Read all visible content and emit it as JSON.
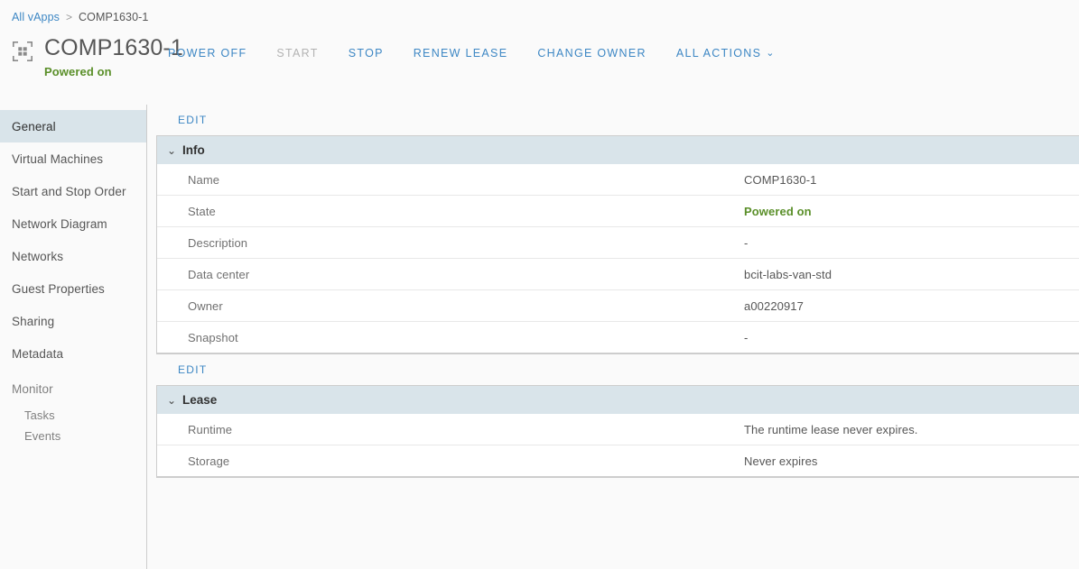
{
  "breadcrumb": {
    "root_label": "All vApps",
    "separator": ">",
    "current_label": "COMP1630-1"
  },
  "header": {
    "icon": "vapp-icon",
    "title": "COMP1630-1",
    "status": "Powered on",
    "status_color": "#5a8f29",
    "actions": [
      {
        "label": "POWER OFF",
        "disabled": false,
        "caret": ""
      },
      {
        "label": "START",
        "disabled": true,
        "caret": ""
      },
      {
        "label": "STOP",
        "disabled": false,
        "caret": ""
      },
      {
        "label": "RENEW LEASE",
        "disabled": false,
        "caret": ""
      },
      {
        "label": "CHANGE OWNER",
        "disabled": false,
        "caret": ""
      },
      {
        "label": "ALL ACTIONS",
        "disabled": false,
        "caret": "⌄"
      }
    ]
  },
  "sidebar": {
    "items": [
      {
        "label": "General",
        "selected": true,
        "kind": "item"
      },
      {
        "label": "Virtual Machines",
        "selected": false,
        "kind": "item"
      },
      {
        "label": "Start and Stop Order",
        "selected": false,
        "kind": "item"
      },
      {
        "label": "Network Diagram",
        "selected": false,
        "kind": "item"
      },
      {
        "label": "Networks",
        "selected": false,
        "kind": "item"
      },
      {
        "label": "Guest Properties",
        "selected": false,
        "kind": "item"
      },
      {
        "label": "Sharing",
        "selected": false,
        "kind": "item"
      },
      {
        "label": "Metadata",
        "selected": false,
        "kind": "item"
      },
      {
        "label": "Monitor",
        "selected": false,
        "kind": "group"
      },
      {
        "label": "Tasks",
        "selected": false,
        "kind": "sub"
      },
      {
        "label": "Events",
        "selected": false,
        "kind": "sub"
      }
    ]
  },
  "main": {
    "sections": [
      {
        "edit_label": "EDIT",
        "title": "Info",
        "chevron": "⌄",
        "rows": [
          {
            "label": "Name",
            "value": "COMP1630-1",
            "highlight": false
          },
          {
            "label": "State",
            "value": "Powered on",
            "highlight": true
          },
          {
            "label": "Description",
            "value": "-",
            "highlight": false
          },
          {
            "label": "Data center",
            "value": "bcit-labs-van-std",
            "highlight": false
          },
          {
            "label": "Owner",
            "value": "a00220917",
            "highlight": false
          },
          {
            "label": "Snapshot",
            "value": "-",
            "highlight": false
          }
        ]
      },
      {
        "edit_label": "EDIT",
        "title": "Lease",
        "chevron": "⌄",
        "rows": [
          {
            "label": "Runtime",
            "value": "The runtime lease never expires.",
            "highlight": false
          },
          {
            "label": "Storage",
            "value": "Never expires",
            "highlight": false
          }
        ]
      }
    ]
  },
  "colors": {
    "accent_link": "#3d87c4",
    "section_header_bg": "#d9e4ea",
    "status_green": "#5a8f29",
    "page_bg": "#fafafa",
    "text_primary": "#565656",
    "text_muted": "#808080"
  }
}
